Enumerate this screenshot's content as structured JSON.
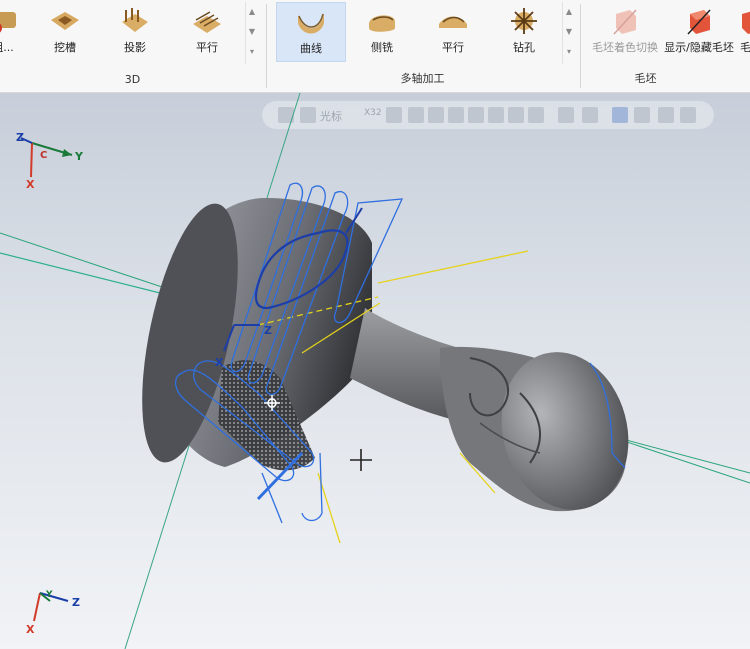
{
  "ribbon": {
    "groups": [
      {
        "label": "3D",
        "buttons": [
          "粗...",
          "挖槽",
          "投影",
          "平行"
        ]
      },
      {
        "label": "多轴加工",
        "buttons": [
          "曲线",
          "侧铣",
          "平行",
          "钻孔"
        ],
        "active": "曲线"
      },
      {
        "label": "毛坯",
        "buttons": [
          "毛坯着色切换",
          "显示/隐藏毛坯",
          "毛坯"
        ]
      }
    ]
  },
  "viewport_toolbar": {
    "text": "光标",
    "scale": "X32"
  },
  "axes": {
    "top": {
      "x": "X",
      "y": "Y",
      "z": "Z",
      "c": "C"
    },
    "bottom": {
      "x": "X",
      "y": "Y",
      "z": "Z"
    },
    "local": {
      "x": "X",
      "z": "Z"
    }
  },
  "colors": {
    "accent": "#2a62c9",
    "toolpath": "#2f6fe0",
    "axis_line": "#1aa36b",
    "yellow": "#e6d21b"
  }
}
